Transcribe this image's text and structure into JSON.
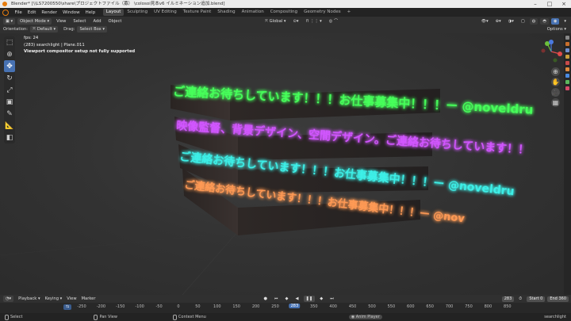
{
  "titlebar": {
    "text": "Blender* [\\\\LS7200550\\share\\プロジェクトファイル（募） \\colosoi見本v6 イルミネーション追加.blend]"
  },
  "menubar": {
    "menus": [
      "File",
      "Edit",
      "Render",
      "Window",
      "Help"
    ],
    "tabs": [
      "Layout",
      "Sculpting",
      "UV Editing",
      "Texture Paint",
      "Shading",
      "Animation",
      "Compositing",
      "Geometry Nodes"
    ],
    "active_tab": "Layout"
  },
  "viewport_header": {
    "mode": "Object Mode",
    "menus": [
      "View",
      "Select",
      "Add",
      "Object"
    ],
    "transform_orientation": "Global",
    "options": "Options",
    "orientation_label": "Orientation:",
    "orientation_value": "Default",
    "drag_label": "Drag:",
    "drag_value": "Select Box"
  },
  "overlay": {
    "fps": "fps: 24",
    "object": "(283) searchlight | Plane.011",
    "warning": "Viewport compositor setup not fully supported"
  },
  "neon_signs": [
    {
      "text": "ご連絡お待ちしています！！！お仕事募集中！！！ー @noveldru",
      "color": "#46ff5a"
    },
    {
      "text": "映像監督、背景デザイン、空間デザイン。ご連絡お待ちしています！！",
      "color": "#d256ff"
    },
    {
      "text": "ご連絡お待ちしています！！！お仕事募集中！！！ー @noveldru",
      "color": "#3ef0e8"
    },
    {
      "text": "ご連絡お待ちしています！！！お仕事募集中！！！ー @nov",
      "color": "#ff9a55"
    }
  ],
  "timeline": {
    "menus": [
      "Playback",
      "Keying",
      "View",
      "Marker"
    ],
    "current_frame": "283",
    "start_label": "Start",
    "start": "0",
    "end_label": "End",
    "end": "360",
    "ticks": [
      "-250",
      "-200",
      "-150",
      "-100",
      "-50",
      "0",
      "50",
      "100",
      "150",
      "200",
      "250",
      "283",
      "350",
      "400",
      "450",
      "500",
      "550",
      "600",
      "650",
      "700",
      "750",
      "800",
      "850"
    ]
  },
  "statusbar": {
    "select": "Select",
    "pan": "Pan View",
    "context": "Context Menu",
    "anim": "Anim Player",
    "right": "searchlight"
  },
  "colors": {
    "accent": "#4772b3",
    "blender_orange": "#e87d0d"
  }
}
